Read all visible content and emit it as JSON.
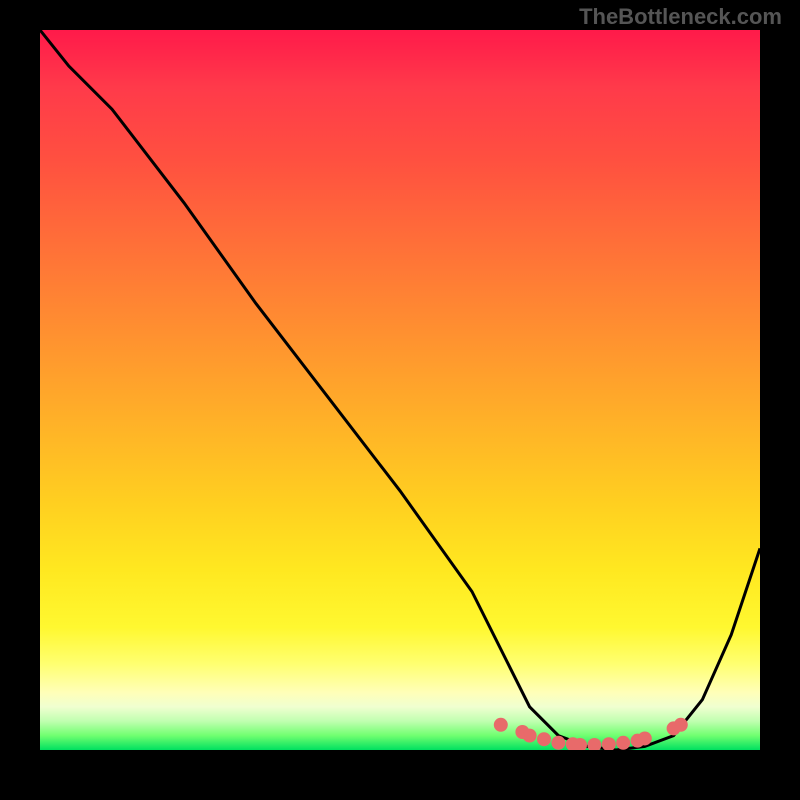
{
  "watermark": "TheBottleneck.com",
  "chart_data": {
    "type": "line",
    "title": "",
    "xlabel": "",
    "ylabel": "",
    "xlim": [
      0,
      100
    ],
    "ylim": [
      0,
      100
    ],
    "series": [
      {
        "name": "bottleneck-curve",
        "x": [
          0,
          4,
          10,
          20,
          30,
          40,
          50,
          60,
          65,
          68,
          72,
          76,
          80,
          84,
          88,
          92,
          96,
          100
        ],
        "values": [
          100,
          95,
          89,
          76,
          62,
          49,
          36,
          22,
          12,
          6,
          2,
          0.5,
          0,
          0.5,
          2,
          7,
          16,
          28
        ]
      }
    ],
    "markers": {
      "name": "bottom-markers",
      "x": [
        64,
        67,
        68,
        70,
        72,
        74,
        75,
        77,
        79,
        81,
        83,
        84,
        88,
        89
      ],
      "values": [
        3.5,
        2.5,
        2,
        1.5,
        1,
        0.8,
        0.7,
        0.7,
        0.8,
        1,
        1.3,
        1.6,
        3,
        3.5
      ]
    },
    "colors": {
      "curve": "#000000",
      "marker": "#e86a6a"
    }
  }
}
